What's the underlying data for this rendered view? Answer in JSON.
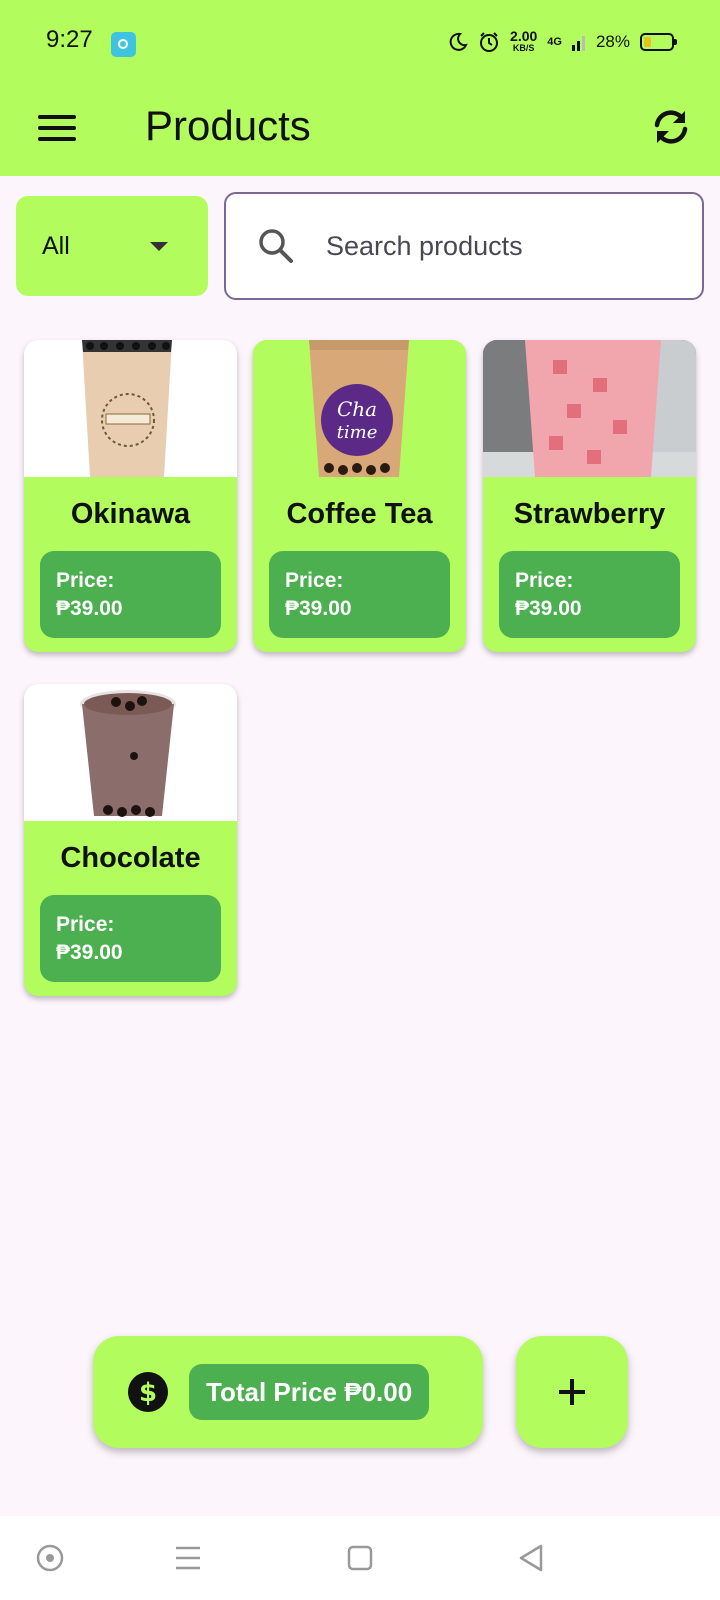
{
  "status_bar": {
    "time": "9:27",
    "speed_value": "2.00",
    "speed_unit": "KB/S",
    "network": "4G",
    "battery_percent": "28%",
    "battery_level": 0.28
  },
  "app_bar": {
    "title": "Products"
  },
  "filter": {
    "category_selected": "All",
    "search_placeholder": "Search products"
  },
  "products": [
    {
      "name": "Okinawa",
      "price_label": "Price:",
      "price": "₱39.00"
    },
    {
      "name": "Coffee Tea",
      "price_label": "Price:",
      "price": "₱39.00"
    },
    {
      "name": "Strawberry",
      "price_label": "Price:",
      "price": "₱39.00"
    },
    {
      "name": "Chocolate",
      "price_label": "Price:",
      "price": "₱39.00"
    }
  ],
  "footer": {
    "total_price_text": "Total Price ₱0.00"
  },
  "colors": {
    "app_bar": "#b3fc5e",
    "price_badge": "#4caf50",
    "background": "#fcf5fc",
    "search_border": "#7a679a"
  },
  "icons": {
    "menu": "hamburger-menu-icon",
    "refresh": "sync-icon",
    "search": "search-icon",
    "dropdown": "dropdown-arrow-icon",
    "total": "dollar-circle-icon",
    "add": "plus-icon"
  }
}
